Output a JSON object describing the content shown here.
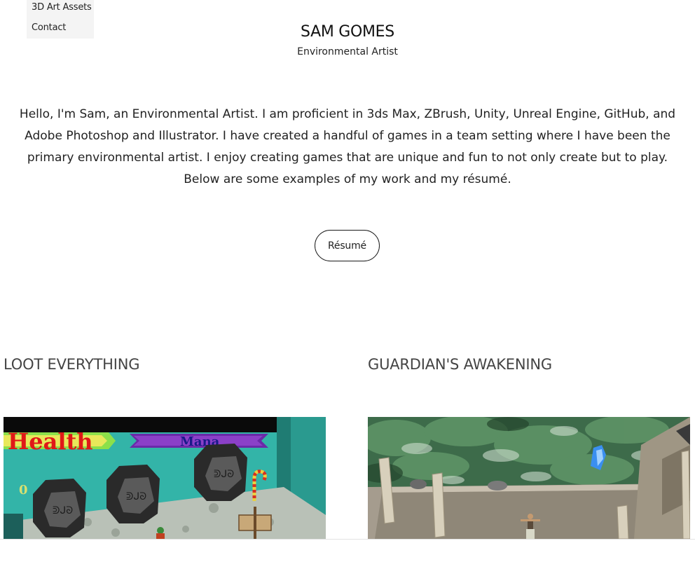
{
  "nav": {
    "items": [
      "3D Art Assets",
      "Contact"
    ]
  },
  "header": {
    "name": "SAM GOMES",
    "tagline": "Environmental Artist"
  },
  "intro": {
    "text": "Hello, I'm Sam, an Environmental Artist. I am proficient in 3ds Max, ZBrush, Unity, Unreal Engine, GitHub, and Adobe Photoshop and Illustrator. I have created a handful of games in a team setting where I have been the primary environmental artist. I enjoy creating games that are unique and fun to not only create but to play. Below are some examples of my work and my résumé."
  },
  "resume_button": {
    "label": "Résumé"
  },
  "projects": [
    {
      "title": "LOOT EVERYTHING",
      "hud": {
        "health_label": "Health",
        "mana_label": "Mana",
        "score": "0"
      }
    },
    {
      "title": "GUARDIAN'S AWAKENING"
    }
  ],
  "colors": {
    "text": "#222222",
    "button_border": "#1a1a1a",
    "nav_bg": "#f4f4f4",
    "project_title": "#444444"
  }
}
